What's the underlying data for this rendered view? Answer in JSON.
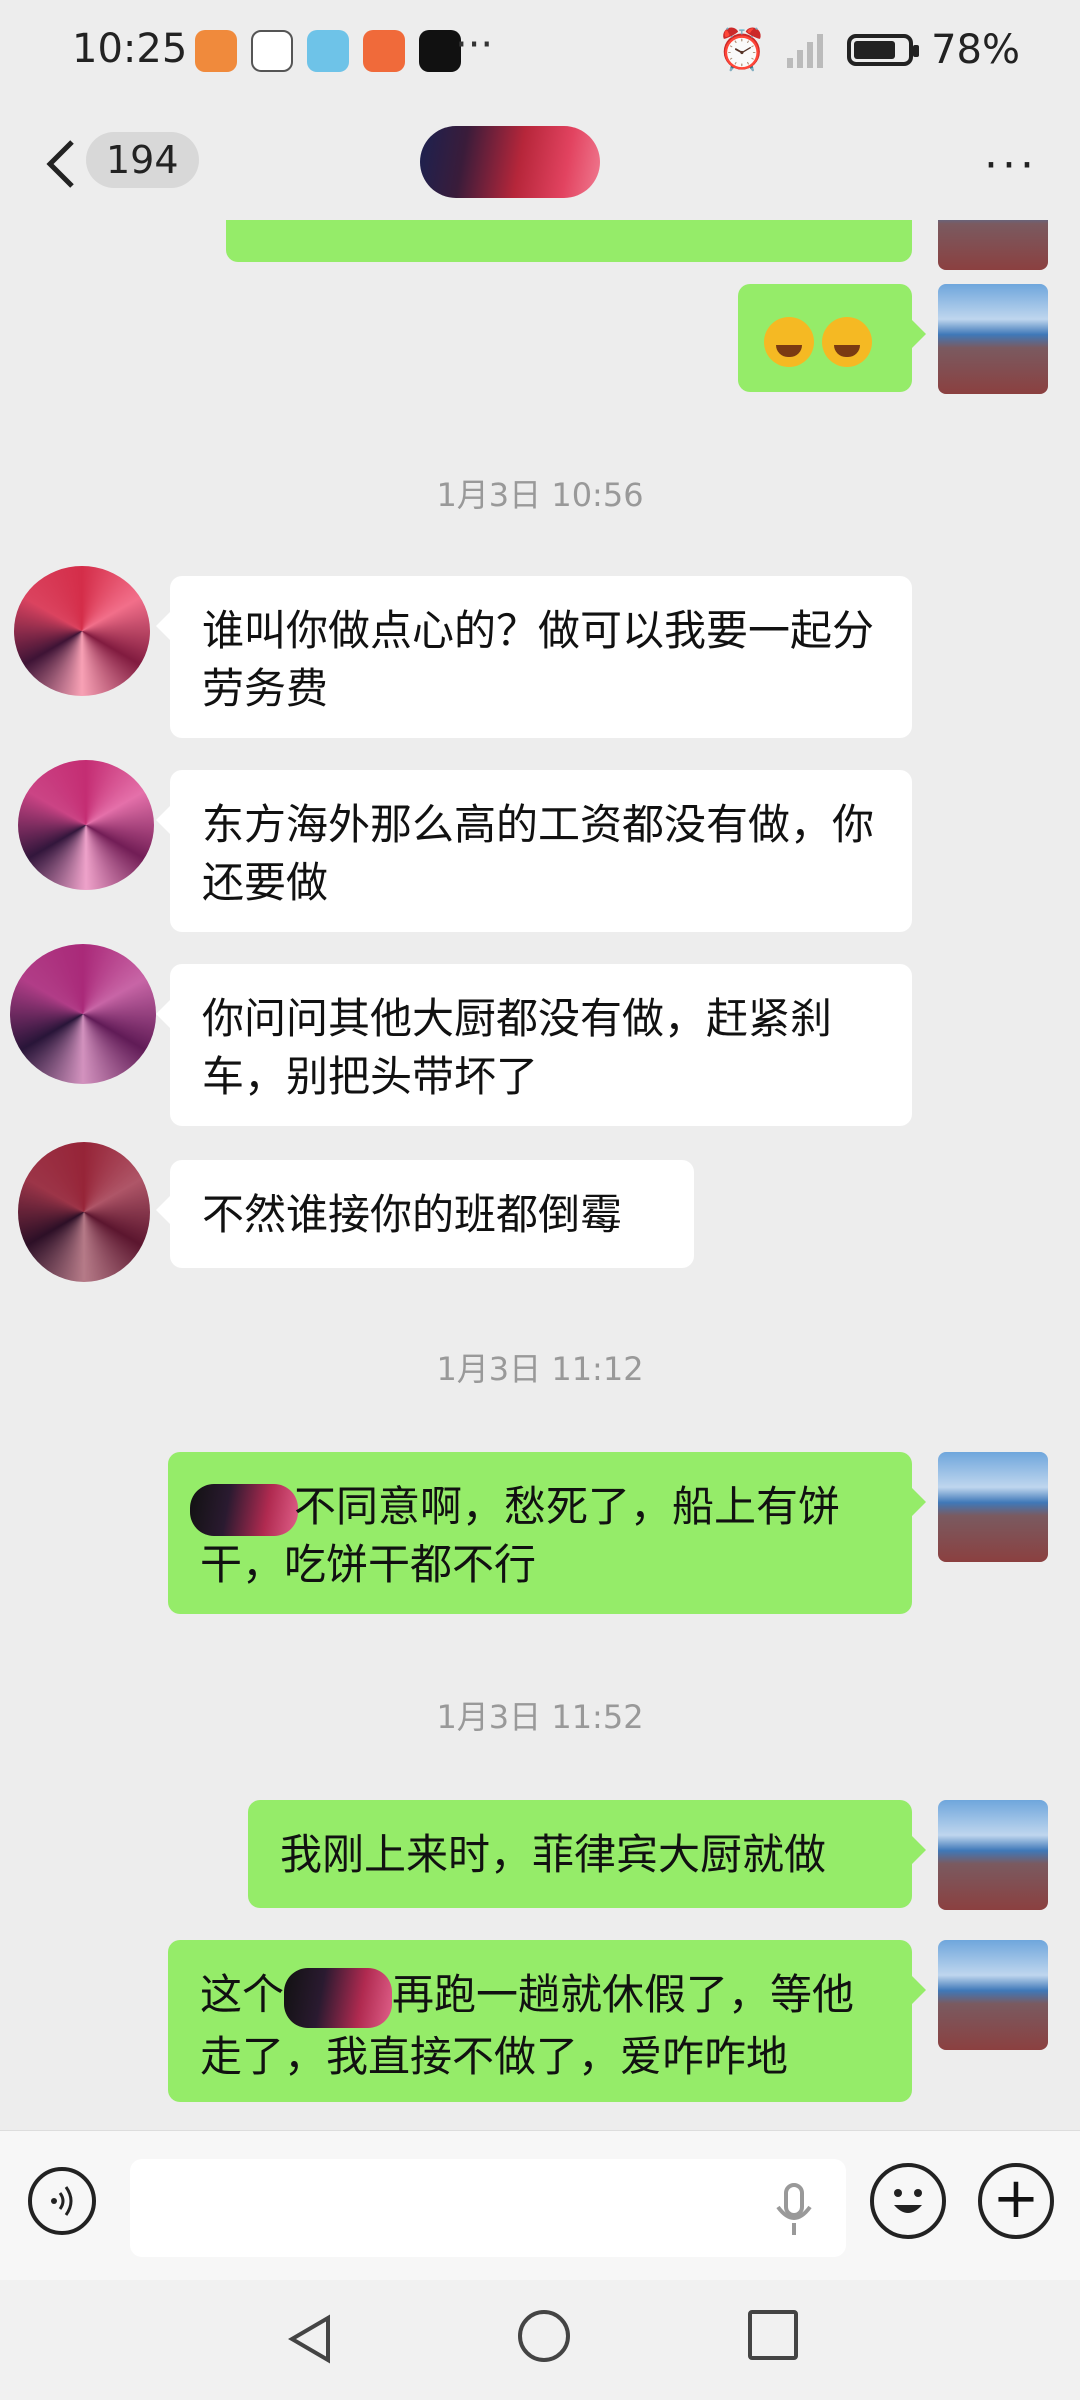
{
  "status_bar": {
    "time": "10:25",
    "battery": "78%",
    "battery_level": 0.78,
    "more_indicator": "···"
  },
  "header": {
    "unread_count": "194",
    "more_label": "···"
  },
  "messages": [
    {
      "side": "right",
      "text": ""
    },
    {
      "side": "right",
      "text": "",
      "emojis": [
        "face-with-tears-of-joy",
        "face-with-tears-of-joy"
      ]
    },
    {
      "timestamp": "1月3日 10:56"
    },
    {
      "side": "left",
      "text": "谁叫你做点心的？做可以我要一起分劳务费"
    },
    {
      "side": "left",
      "text": "东方海外那么高的工资都没有做，你还要做"
    },
    {
      "side": "left",
      "text": "你问问其他大厨都没有做，赶紧刹车，别把头带坏了"
    },
    {
      "side": "left",
      "text": "不然谁接你的班都倒霉"
    },
    {
      "timestamp": "1月3日 11:12"
    },
    {
      "side": "right",
      "text": "不同意啊，愁死了，船上有饼干，吃饼干都不行",
      "redacted_prefix": true
    },
    {
      "timestamp": "1月3日 11:52"
    },
    {
      "side": "right",
      "text": "我刚上来时，菲律宾大厨就做"
    },
    {
      "side": "right",
      "text_part1": "这个",
      "text_part2": "再跑一趟就休假了，等他走了，我直接不做了，爱咋咋地"
    }
  ],
  "input": {
    "value": ""
  },
  "colors": {
    "outgoing_bubble": "#95ec69",
    "incoming_bubble": "#ffffff",
    "background": "#ededed"
  }
}
